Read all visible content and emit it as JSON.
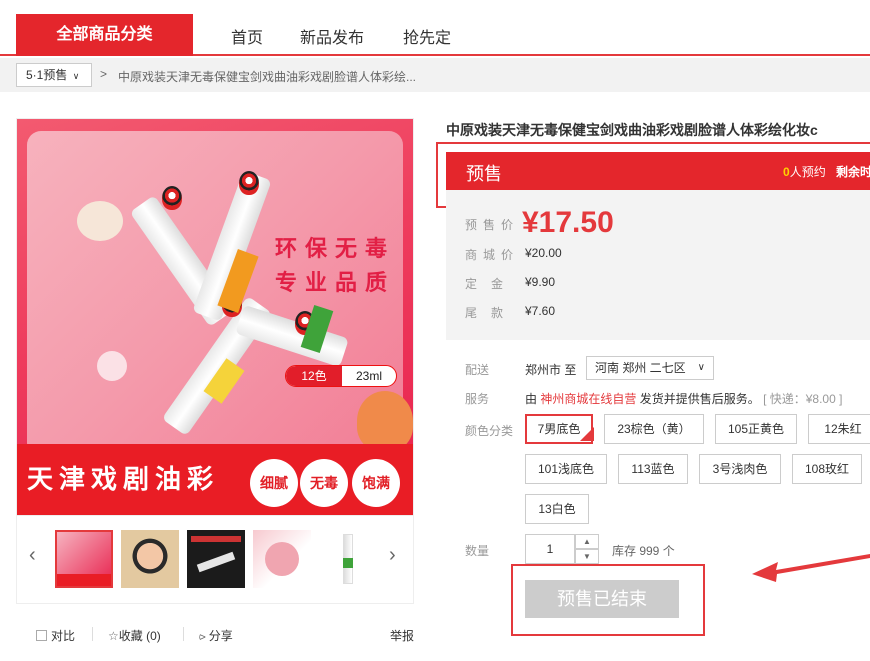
{
  "nav": {
    "all_categories": "全部商品分类",
    "links": [
      "首页",
      "新品发布",
      "抢先定"
    ]
  },
  "breadcrumb": {
    "dropdown": "5·1预售",
    "arrow": ">",
    "title": "中原戏装天津无毒保健宝剑戏曲油彩戏剧脸谱人体彩绘..."
  },
  "gallery": {
    "slogan_1": "环保无毒",
    "slogan_2": "专业品质",
    "spec_colors": "12色",
    "spec_volume": "23ml",
    "band_title": "天津戏剧油彩",
    "badges": [
      "细腻",
      "无毒",
      "饱满"
    ],
    "prev_icon": "‹",
    "next_icon": "›"
  },
  "actions": {
    "compare": "对比",
    "favorite": "收藏 (0)",
    "share": "分享",
    "report": "举报"
  },
  "product": {
    "title": "中原戏装天津无毒保健宝剑戏曲油彩戏剧脸谱人体彩绘化妆c",
    "presale_label": "预售",
    "reserve_count": "0",
    "reserve_suffix": "人预约",
    "remaining": "剩余时",
    "prices": {
      "presale_label": "预售价",
      "presale_value": "¥17.50",
      "mall_label": "商城价",
      "mall_value": "¥20.00",
      "deposit_label": "定金",
      "deposit_value": "¥9.90",
      "balance_label": "尾款",
      "balance_value": "¥7.60"
    },
    "delivery_label": "配送",
    "ship_from": "郑州市 至",
    "ship_to": "河南 郑州 二七区",
    "service_label": "服务",
    "service_prefix": "由",
    "service_shop": "神州商城在线自营",
    "service_mid": "发货并提供售后服务。",
    "service_fee": "[ 快递：¥8.00 ]",
    "color_label": "颜色分类",
    "colors": [
      "7男底色",
      "23棕色（黄）",
      "105正黄色",
      "12朱红",
      "101浅底色",
      "113蓝色",
      "3号浅肉色",
      "108玫红",
      "13白色"
    ],
    "selected_color": "7男底色",
    "qty_label": "数量",
    "qty_value": "1",
    "stock": "库存 999 个",
    "buy_button": "预售已结束"
  },
  "colors": {
    "brand_red": "#e4393c",
    "price_bg": "#f3f3f3",
    "disabled_btn": "#cccccc"
  }
}
